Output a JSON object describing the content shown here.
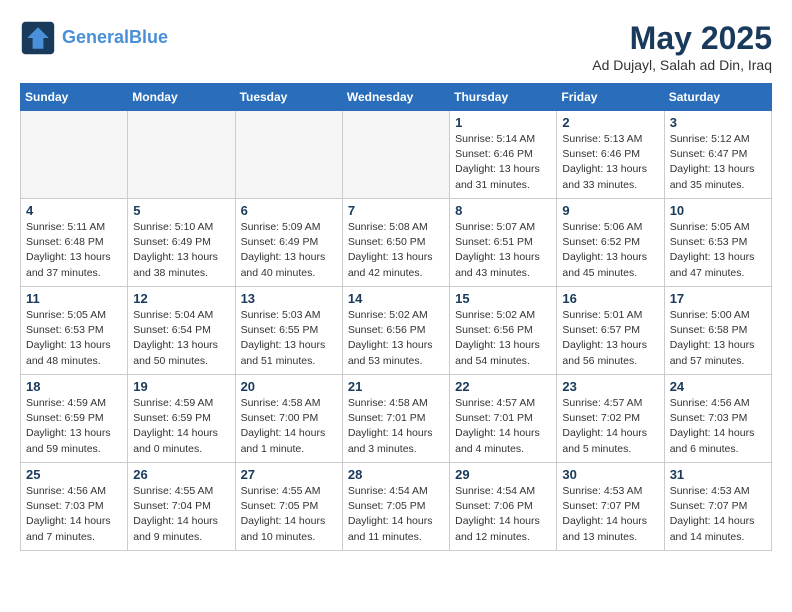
{
  "header": {
    "logo_line1": "General",
    "logo_line2": "Blue",
    "month_year": "May 2025",
    "location": "Ad Dujayl, Salah ad Din, Iraq"
  },
  "days_of_week": [
    "Sunday",
    "Monday",
    "Tuesday",
    "Wednesday",
    "Thursday",
    "Friday",
    "Saturday"
  ],
  "weeks": [
    [
      {
        "day": "",
        "empty": true
      },
      {
        "day": "",
        "empty": true
      },
      {
        "day": "",
        "empty": true
      },
      {
        "day": "",
        "empty": true
      },
      {
        "day": "1",
        "sunrise": "5:14 AM",
        "sunset": "6:46 PM",
        "daylight": "13 hours and 31 minutes."
      },
      {
        "day": "2",
        "sunrise": "5:13 AM",
        "sunset": "6:46 PM",
        "daylight": "13 hours and 33 minutes."
      },
      {
        "day": "3",
        "sunrise": "5:12 AM",
        "sunset": "6:47 PM",
        "daylight": "13 hours and 35 minutes."
      }
    ],
    [
      {
        "day": "4",
        "sunrise": "5:11 AM",
        "sunset": "6:48 PM",
        "daylight": "13 hours and 37 minutes."
      },
      {
        "day": "5",
        "sunrise": "5:10 AM",
        "sunset": "6:49 PM",
        "daylight": "13 hours and 38 minutes."
      },
      {
        "day": "6",
        "sunrise": "5:09 AM",
        "sunset": "6:49 PM",
        "daylight": "13 hours and 40 minutes."
      },
      {
        "day": "7",
        "sunrise": "5:08 AM",
        "sunset": "6:50 PM",
        "daylight": "13 hours and 42 minutes."
      },
      {
        "day": "8",
        "sunrise": "5:07 AM",
        "sunset": "6:51 PM",
        "daylight": "13 hours and 43 minutes."
      },
      {
        "day": "9",
        "sunrise": "5:06 AM",
        "sunset": "6:52 PM",
        "daylight": "13 hours and 45 minutes."
      },
      {
        "day": "10",
        "sunrise": "5:05 AM",
        "sunset": "6:53 PM",
        "daylight": "13 hours and 47 minutes."
      }
    ],
    [
      {
        "day": "11",
        "sunrise": "5:05 AM",
        "sunset": "6:53 PM",
        "daylight": "13 hours and 48 minutes."
      },
      {
        "day": "12",
        "sunrise": "5:04 AM",
        "sunset": "6:54 PM",
        "daylight": "13 hours and 50 minutes."
      },
      {
        "day": "13",
        "sunrise": "5:03 AM",
        "sunset": "6:55 PM",
        "daylight": "13 hours and 51 minutes."
      },
      {
        "day": "14",
        "sunrise": "5:02 AM",
        "sunset": "6:56 PM",
        "daylight": "13 hours and 53 minutes."
      },
      {
        "day": "15",
        "sunrise": "5:02 AM",
        "sunset": "6:56 PM",
        "daylight": "13 hours and 54 minutes."
      },
      {
        "day": "16",
        "sunrise": "5:01 AM",
        "sunset": "6:57 PM",
        "daylight": "13 hours and 56 minutes."
      },
      {
        "day": "17",
        "sunrise": "5:00 AM",
        "sunset": "6:58 PM",
        "daylight": "13 hours and 57 minutes."
      }
    ],
    [
      {
        "day": "18",
        "sunrise": "4:59 AM",
        "sunset": "6:59 PM",
        "daylight": "13 hours and 59 minutes."
      },
      {
        "day": "19",
        "sunrise": "4:59 AM",
        "sunset": "6:59 PM",
        "daylight": "14 hours and 0 minutes."
      },
      {
        "day": "20",
        "sunrise": "4:58 AM",
        "sunset": "7:00 PM",
        "daylight": "14 hours and 1 minute."
      },
      {
        "day": "21",
        "sunrise": "4:58 AM",
        "sunset": "7:01 PM",
        "daylight": "14 hours and 3 minutes."
      },
      {
        "day": "22",
        "sunrise": "4:57 AM",
        "sunset": "7:01 PM",
        "daylight": "14 hours and 4 minutes."
      },
      {
        "day": "23",
        "sunrise": "4:57 AM",
        "sunset": "7:02 PM",
        "daylight": "14 hours and 5 minutes."
      },
      {
        "day": "24",
        "sunrise": "4:56 AM",
        "sunset": "7:03 PM",
        "daylight": "14 hours and 6 minutes."
      }
    ],
    [
      {
        "day": "25",
        "sunrise": "4:56 AM",
        "sunset": "7:03 PM",
        "daylight": "14 hours and 7 minutes."
      },
      {
        "day": "26",
        "sunrise": "4:55 AM",
        "sunset": "7:04 PM",
        "daylight": "14 hours and 9 minutes."
      },
      {
        "day": "27",
        "sunrise": "4:55 AM",
        "sunset": "7:05 PM",
        "daylight": "14 hours and 10 minutes."
      },
      {
        "day": "28",
        "sunrise": "4:54 AM",
        "sunset": "7:05 PM",
        "daylight": "14 hours and 11 minutes."
      },
      {
        "day": "29",
        "sunrise": "4:54 AM",
        "sunset": "7:06 PM",
        "daylight": "14 hours and 12 minutes."
      },
      {
        "day": "30",
        "sunrise": "4:53 AM",
        "sunset": "7:07 PM",
        "daylight": "14 hours and 13 minutes."
      },
      {
        "day": "31",
        "sunrise": "4:53 AM",
        "sunset": "7:07 PM",
        "daylight": "14 hours and 14 minutes."
      }
    ]
  ]
}
